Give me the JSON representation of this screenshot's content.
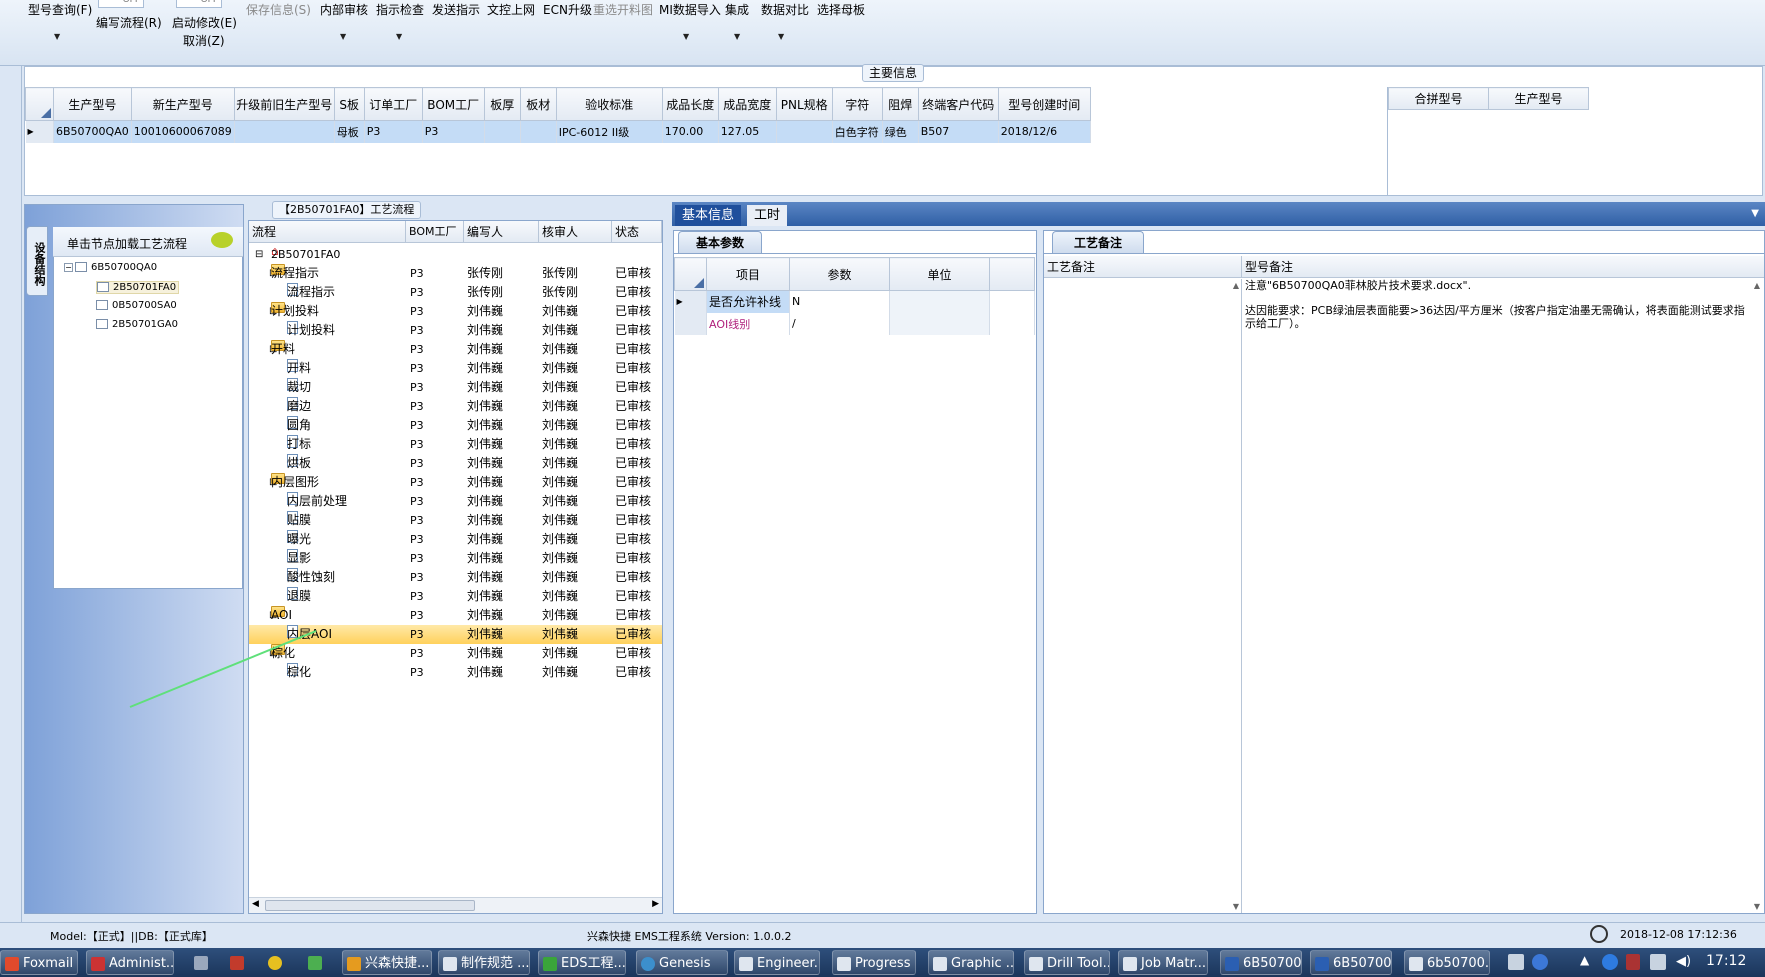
{
  "toolbar": {
    "items": [
      {
        "label": "型号查询(F)",
        "enabled": true
      },
      {
        "label": "编写流程(R)",
        "enabled": true
      },
      {
        "label": "启动修改(E)",
        "enabled": true
      },
      {
        "label": "取消(Z)",
        "enabled": true
      },
      {
        "label": "保存信息(S)",
        "enabled": false
      },
      {
        "label": "内部审核",
        "enabled": true
      },
      {
        "label": "指示检查",
        "enabled": true
      },
      {
        "label": "发送指示",
        "enabled": true
      },
      {
        "label": "文控上网",
        "enabled": true
      },
      {
        "label": "ECN升级",
        "enabled": true
      },
      {
        "label": "重选开料图",
        "enabled": false
      },
      {
        "label": "MI数据导入",
        "enabled": true
      },
      {
        "label": "集成",
        "enabled": true
      },
      {
        "label": "数据对比",
        "enabled": true
      },
      {
        "label": "选择母板",
        "enabled": true
      }
    ],
    "toggle_off_label": "OFF"
  },
  "main_info": {
    "title": "主要信息",
    "columns": [
      "生产型号",
      "新生产型号",
      "升级前旧生产型号",
      "S板",
      "订单工厂",
      "BOM工厂",
      "板厚",
      "板材",
      "验收标准",
      "成品长度",
      "成品宽度",
      "PNL规格",
      "字符",
      "阻焊",
      "终端客户代码",
      "型号创建时间"
    ],
    "row": [
      "6B50700QA0",
      "10010600067089",
      "",
      "母板",
      "P3",
      "P3",
      "",
      "",
      "IPC-6012 II级",
      "170.00",
      "127.05",
      "",
      "白色字符",
      "绿色",
      "B507",
      "2018/12/6"
    ],
    "side_columns": [
      "合拼型号",
      "生产型号"
    ]
  },
  "struct_panel": {
    "vertical_tab": "设备结构",
    "header": "单击节点加载工艺流程",
    "tree": [
      {
        "label": "6B50700QA0",
        "level": 0
      },
      {
        "label": "2B50701FA0",
        "level": 1,
        "selected": true
      },
      {
        "label": "0B50700SA0",
        "level": 1
      },
      {
        "label": "2B50701GA0",
        "level": 1
      }
    ]
  },
  "flow_panel": {
    "title": "【2B50701FA0】工艺流程",
    "columns": [
      "流程",
      "BOM工厂",
      "编写人",
      "核审人",
      "状态"
    ],
    "root": "2B50701FA0",
    "rows": [
      {
        "name": "流程指示",
        "type": "folder",
        "factory": "P3",
        "writer": "张传刚",
        "reviewer": "张传刚",
        "status": "已审核"
      },
      {
        "name": "流程指示",
        "type": "doc",
        "factory": "P3",
        "writer": "张传刚",
        "reviewer": "张传刚",
        "status": "已审核"
      },
      {
        "name": "计划投料",
        "type": "folder",
        "factory": "P3",
        "writer": "刘伟巍",
        "reviewer": "刘伟巍",
        "status": "已审核"
      },
      {
        "name": "计划投料",
        "type": "doc",
        "factory": "P3",
        "writer": "刘伟巍",
        "reviewer": "刘伟巍",
        "status": "已审核"
      },
      {
        "name": "开料",
        "type": "folder",
        "factory": "P3",
        "writer": "刘伟巍",
        "reviewer": "刘伟巍",
        "status": "已审核"
      },
      {
        "name": "开料",
        "type": "doc",
        "factory": "P3",
        "writer": "刘伟巍",
        "reviewer": "刘伟巍",
        "status": "已审核"
      },
      {
        "name": "裁切",
        "type": "doc",
        "factory": "P3",
        "writer": "刘伟巍",
        "reviewer": "刘伟巍",
        "status": "已审核"
      },
      {
        "name": "磨边",
        "type": "doc",
        "factory": "P3",
        "writer": "刘伟巍",
        "reviewer": "刘伟巍",
        "status": "已审核"
      },
      {
        "name": "圆角",
        "type": "doc",
        "factory": "P3",
        "writer": "刘伟巍",
        "reviewer": "刘伟巍",
        "status": "已审核"
      },
      {
        "name": "打标",
        "type": "doc",
        "factory": "P3",
        "writer": "刘伟巍",
        "reviewer": "刘伟巍",
        "status": "已审核"
      },
      {
        "name": "烘板",
        "type": "doc",
        "factory": "P3",
        "writer": "刘伟巍",
        "reviewer": "刘伟巍",
        "status": "已审核"
      },
      {
        "name": "内层图形",
        "type": "folder",
        "factory": "P3",
        "writer": "刘伟巍",
        "reviewer": "刘伟巍",
        "status": "已审核"
      },
      {
        "name": "内层前处理",
        "type": "doc",
        "factory": "P3",
        "writer": "刘伟巍",
        "reviewer": "刘伟巍",
        "status": "已审核"
      },
      {
        "name": "贴膜",
        "type": "doc",
        "factory": "P3",
        "writer": "刘伟巍",
        "reviewer": "刘伟巍",
        "status": "已审核"
      },
      {
        "name": "曝光",
        "type": "doc",
        "factory": "P3",
        "writer": "刘伟巍",
        "reviewer": "刘伟巍",
        "status": "已审核"
      },
      {
        "name": "显影",
        "type": "doc",
        "factory": "P3",
        "writer": "刘伟巍",
        "reviewer": "刘伟巍",
        "status": "已审核"
      },
      {
        "name": "酸性蚀刻",
        "type": "doc",
        "factory": "P3",
        "writer": "刘伟巍",
        "reviewer": "刘伟巍",
        "status": "已审核"
      },
      {
        "name": "退膜",
        "type": "doc",
        "factory": "P3",
        "writer": "刘伟巍",
        "reviewer": "刘伟巍",
        "status": "已审核"
      },
      {
        "name": "AOI",
        "type": "folder",
        "factory": "P3",
        "writer": "刘伟巍",
        "reviewer": "刘伟巍",
        "status": "已审核"
      },
      {
        "name": "内层AOI",
        "type": "doc",
        "factory": "P3",
        "writer": "刘伟巍",
        "reviewer": "刘伟巍",
        "status": "已审核",
        "highlight": true
      },
      {
        "name": "棕化",
        "type": "folder",
        "factory": "P3",
        "writer": "刘伟巍",
        "reviewer": "刘伟巍",
        "status": "已审核"
      },
      {
        "name": "棕化",
        "type": "doc",
        "factory": "P3",
        "writer": "刘伟巍",
        "reviewer": "刘伟巍",
        "status": "已审核"
      }
    ]
  },
  "right_tabs": {
    "tabs": [
      "基本信息",
      "工时"
    ],
    "active": 0
  },
  "params": {
    "tab": "基本参数",
    "columns": [
      "项目",
      "参数",
      "单位"
    ],
    "rows": [
      {
        "item": "是否允许补线",
        "value": "N",
        "unit": ""
      },
      {
        "item": "AOI线别",
        "value": "/",
        "unit": ""
      }
    ]
  },
  "notes": {
    "tab": "工艺备注",
    "columns": [
      "工艺备注",
      "型号备注"
    ],
    "model_note_line1": "注意\"6B50700QA0菲林胶片技术要求.docx\".",
    "model_note_line2": "达因能要求：PCB绿油层表面能要>36达因/平方厘米（按客户指定油墨无需确认，将表面能测试要求指示给工厂）。"
  },
  "statusbar": {
    "left": "Model:【正式】||DB:【正式库】",
    "center": "兴森快捷 EMS工程系统 Version: 1.0.0.2",
    "datetime": "2018-12-08 17:12:36"
  },
  "taskbar": {
    "items": [
      "Foxmail",
      "Administ...",
      "",
      "",
      "",
      "",
      "兴森快捷...",
      "制作规范 ...",
      "EDS工程...",
      "Genesis",
      "Engineer...",
      "Progress",
      "Graphic ...",
      "Drill Tool...",
      "Job Matr...",
      "6B50700...",
      "6B50700...",
      "6b50700..."
    ],
    "clock": "17:12"
  },
  "colors": {
    "accent": "#2f5fa5",
    "selection": "#c4dcf6",
    "highlight": "#ffd15c",
    "taskbar": "#1b355a"
  }
}
